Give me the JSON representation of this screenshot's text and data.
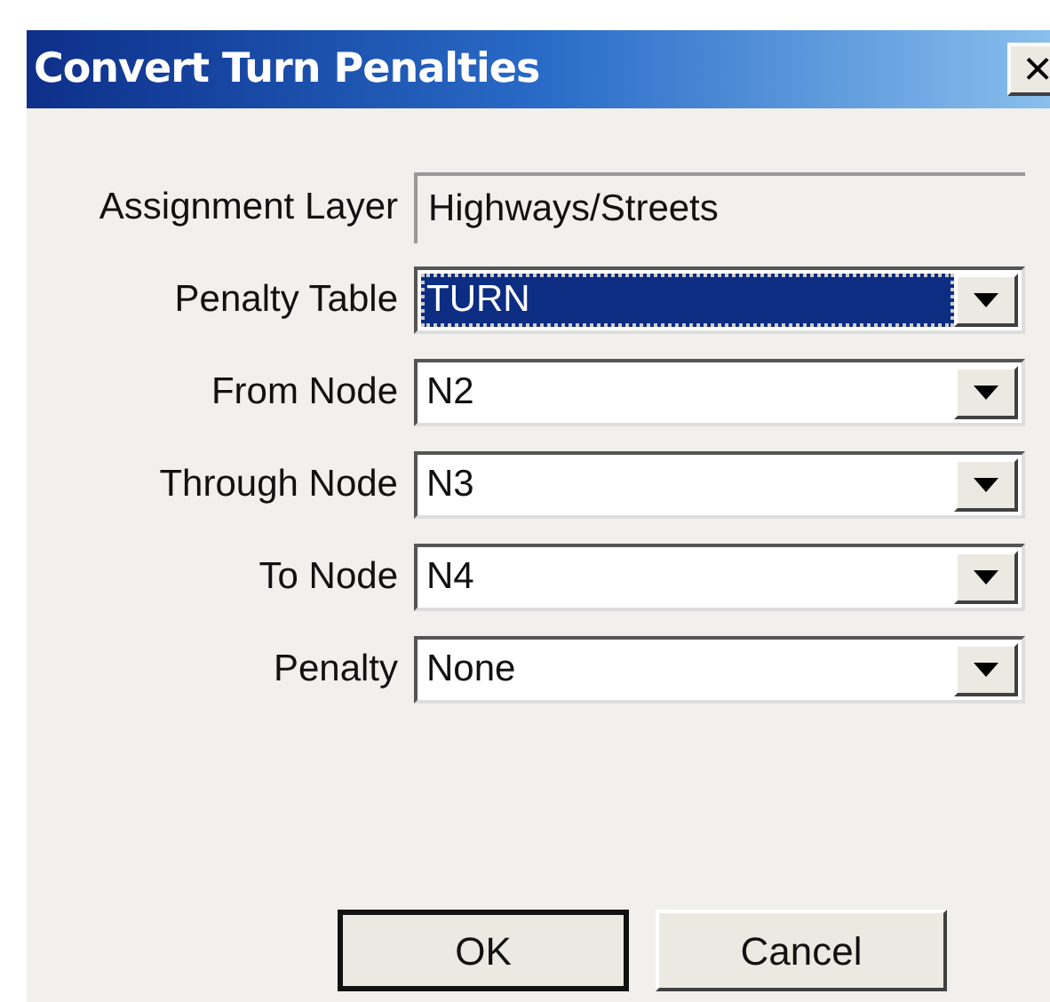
{
  "window": {
    "title": "Convert Turn Penalties",
    "close": "×"
  },
  "fields": [
    {
      "label": "Assignment Layer",
      "value": "Highways/Streets",
      "kind": "readonly"
    },
    {
      "label": "Penalty Table",
      "value": "TURN",
      "kind": "dropdown",
      "selected": true
    },
    {
      "label": "From Node",
      "value": "N2",
      "kind": "dropdown",
      "selected": false
    },
    {
      "label": "Through Node",
      "value": "N3",
      "kind": "dropdown",
      "selected": false
    },
    {
      "label": "To Node",
      "value": "N4",
      "kind": "dropdown",
      "selected": false
    },
    {
      "label": "Penalty",
      "value": "None",
      "kind": "dropdown",
      "selected": false
    }
  ],
  "buttons": [
    {
      "label": "OK",
      "default": true
    },
    {
      "label": "Cancel",
      "default": false
    }
  ]
}
